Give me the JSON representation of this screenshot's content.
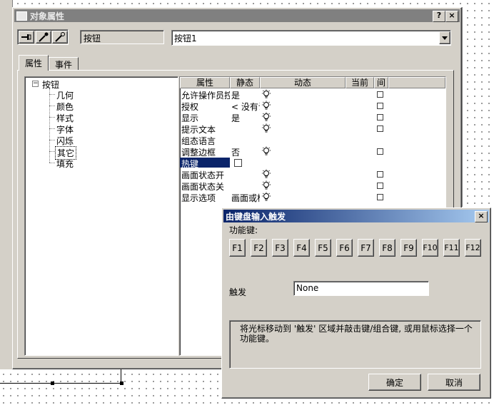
{
  "main_window": {
    "title": "对象属性",
    "help_btn": "?",
    "close_btn": "×",
    "object_type": "按钮",
    "object_name": "按钮1",
    "tabs": [
      {
        "label": "属性"
      },
      {
        "label": "事件"
      }
    ]
  },
  "tree": {
    "root": "按钮",
    "children": [
      "几何",
      "颜色",
      "样式",
      "字体",
      "闪烁",
      "其它",
      "填充"
    ],
    "selected": "其它"
  },
  "props": {
    "headers": [
      "属性",
      "静态",
      "动态",
      "当前",
      "间"
    ],
    "rows": [
      {
        "name": "允许操作员控",
        "static": "是",
        "bulb": true,
        "chk": true
      },
      {
        "name": "授权",
        "static": "< 没有访",
        "bulb": true,
        "chk": true
      },
      {
        "name": "显示",
        "static": "是",
        "bulb": true,
        "chk": true
      },
      {
        "name": "提示文本",
        "static": "",
        "bulb": true,
        "chk": true
      },
      {
        "name": "组态语言",
        "static": "",
        "bulb": false,
        "chk": false
      },
      {
        "name": "调整边框",
        "static": "否",
        "bulb": true,
        "chk": true
      },
      {
        "name": "热键",
        "static": "",
        "bulb": false,
        "chk": false,
        "selected": true,
        "static_chk": true
      },
      {
        "name": "画面状态开",
        "static": "",
        "bulb": true,
        "chk": true
      },
      {
        "name": "画面状态关",
        "static": "",
        "bulb": true,
        "chk": true
      },
      {
        "name": "显示选项",
        "static": "画面或框",
        "bulb": true,
        "chk": true
      }
    ]
  },
  "dialog": {
    "title": "由键盘输入触发",
    "close_btn": "×",
    "fkeys_label": "功能键:",
    "fkeys": [
      "F1",
      "F2",
      "F3",
      "F4",
      "F5",
      "F6",
      "F7",
      "F8",
      "F9",
      "F10",
      "F11",
      "F12"
    ],
    "trigger_label": "触发",
    "trigger_value": "None",
    "hint": "将光标移动到 '触发' 区域并敲击键/组合键, 或用鼠标选择一个功能键。",
    "ok": "确定",
    "cancel": "取消"
  },
  "colors": {
    "title_active": "#0a246a",
    "title_inactive": "#808080",
    "face": "#d4d0c8",
    "selection": "#0a246a"
  }
}
